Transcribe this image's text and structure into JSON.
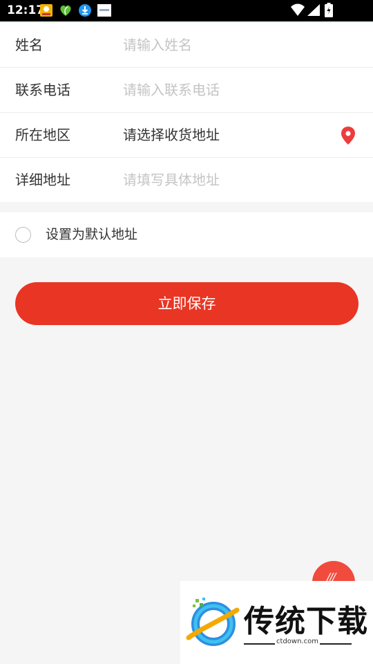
{
  "status_bar": {
    "time": "12:17"
  },
  "form": {
    "name": {
      "label": "姓名",
      "placeholder": "请输入姓名"
    },
    "phone": {
      "label": "联系电话",
      "placeholder": "请输入联系电话"
    },
    "region": {
      "label": "所在地区",
      "value": "请选择收货地址"
    },
    "address": {
      "label": "详细地址",
      "placeholder": "请填写具体地址"
    }
  },
  "default_option": {
    "label": "设置为默认地址",
    "checked": false
  },
  "save_button": {
    "label": "立即保存"
  },
  "watermark": {
    "title": "传统下载",
    "url": "ctdown.com"
  },
  "colors": {
    "accent": "#e93524",
    "location_pin": "#ee3b3b",
    "placeholder": "#c4c4c4",
    "text": "#333333"
  }
}
